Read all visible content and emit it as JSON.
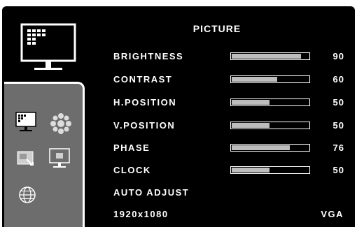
{
  "title": "PICTURE",
  "items": [
    {
      "label": "BRIGHTNESS",
      "value": "90",
      "level": 0.9
    },
    {
      "label": "CONTRAST",
      "value": "60",
      "level": 0.6
    },
    {
      "label": "H.POSITION",
      "value": "50",
      "level": 0.5
    },
    {
      "label": "V.POSITION",
      "value": "50",
      "level": 0.5
    },
    {
      "label": "PHASE",
      "value": "76",
      "level": 0.76
    },
    {
      "label": "CLOCK",
      "value": "50",
      "level": 0.5
    }
  ],
  "auto_adjust_label": "AUTO ADJUST",
  "status": {
    "resolution": "1920x1080",
    "input_source": "VGA"
  },
  "icons": [
    "picture-menu-icon",
    "picture-tab-icon",
    "color-tab-icon",
    "image-adjust-tab-icon",
    "display-settings-tab-icon",
    "language-tab-icon"
  ],
  "colors": {
    "background": "#000000",
    "side_panel": "#6d6d6d",
    "bar_fill": "#bdbdbd",
    "text": "#ffffff"
  }
}
